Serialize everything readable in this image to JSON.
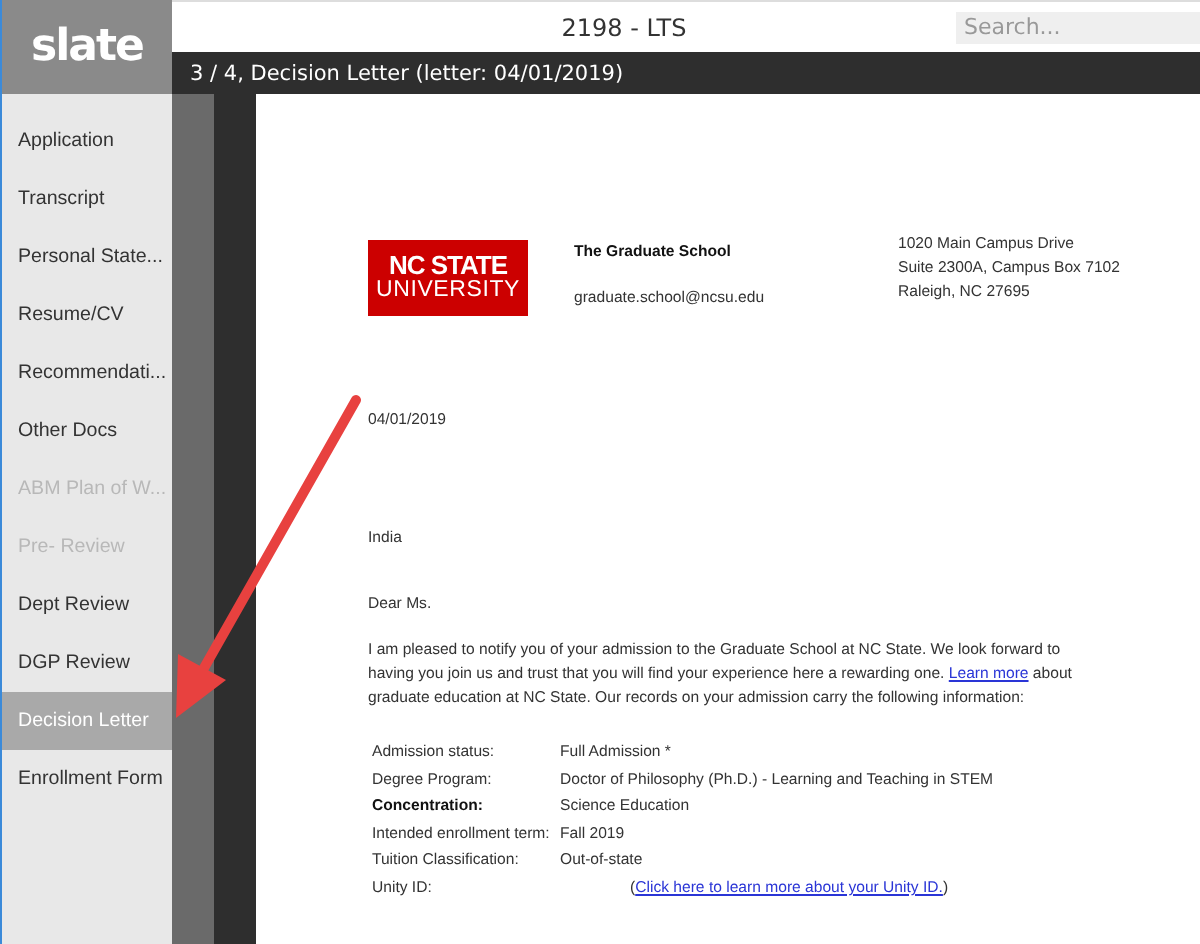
{
  "app": {
    "logo": "slate",
    "title": "2198 - LTS",
    "search": {
      "placeholder": "Search..."
    }
  },
  "sidebar": {
    "items": [
      {
        "label": "Application",
        "disabled": false,
        "selected": false
      },
      {
        "label": "Transcript",
        "disabled": false,
        "selected": false
      },
      {
        "label": "Personal State...",
        "disabled": false,
        "selected": false
      },
      {
        "label": "Resume/CV",
        "disabled": false,
        "selected": false
      },
      {
        "label": "Recommendati...",
        "disabled": false,
        "selected": false
      },
      {
        "label": "Other Docs",
        "disabled": false,
        "selected": false
      },
      {
        "label": "ABM Plan of W...",
        "disabled": true,
        "selected": false
      },
      {
        "label": "Pre- Review",
        "disabled": true,
        "selected": false
      },
      {
        "label": "Dept Review",
        "disabled": false,
        "selected": false
      },
      {
        "label": "DGP Review",
        "disabled": false,
        "selected": false
      },
      {
        "label": "Decision Letter",
        "disabled": false,
        "selected": true
      },
      {
        "label": "Enrollment Form",
        "disabled": false,
        "selected": false
      }
    ]
  },
  "document_header": "3 / 4, Decision Letter (letter: 04/01/2019)",
  "letter": {
    "logo": {
      "line_1": "NC STATE",
      "line_2": "UNIVERSITY"
    },
    "sender": "The Graduate School",
    "email": "graduate.school@ncsu.edu",
    "address": [
      "1020 Main Campus Drive",
      "Suite 2300A, Campus Box 7102",
      "Raleigh, NC 27695"
    ],
    "date": "04/01/2019",
    "country": "India",
    "salutation": "Dear Ms.",
    "paragraph": {
      "before": "I am pleased to notify you of your admission to the Graduate School at NC State. We look forward to having you join us and trust that you will find your experience here a rewarding one.",
      "link": "Learn more",
      "after": "about graduate education at NC State. Our records on your admission carry the following information:"
    },
    "details": [
      {
        "kind": "text",
        "label": "Admission status:",
        "bold": false,
        "value": "Full Admission *"
      },
      {
        "kind": "text",
        "label": "Degree Program:",
        "bold": false,
        "value": "Doctor of Philosophy (Ph.D.) - Learning and Teaching in STEM"
      },
      {
        "kind": "text",
        "label": "Concentration:",
        "bold": true,
        "value": "Science Education"
      },
      {
        "kind": "text",
        "label": "Intended enrollment term:",
        "bold": false,
        "value": "Fall 2019"
      },
      {
        "kind": "text",
        "label": "Tuition Classification:",
        "bold": false,
        "value": "Out-of-state"
      },
      {
        "kind": "link",
        "label": "Unity ID:",
        "bold": false,
        "before": "(",
        "link": "Click here to learn more about your Unity ID.",
        "after": ")"
      }
    ]
  }
}
